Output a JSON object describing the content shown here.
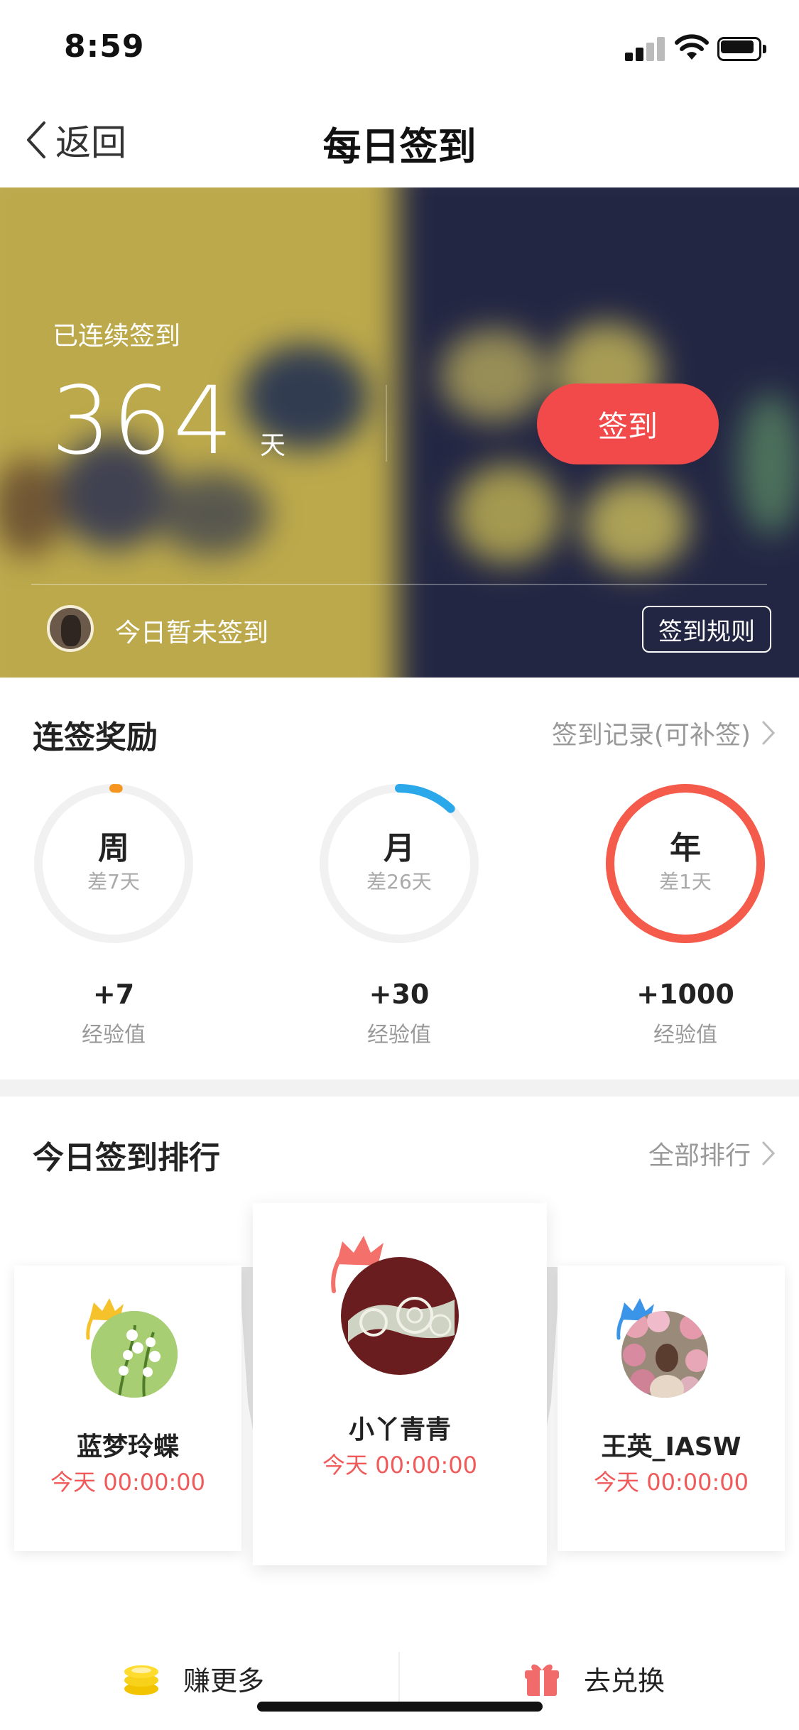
{
  "status_bar": {
    "time": "8:59"
  },
  "nav": {
    "back_label": "返回",
    "title": "每日签到"
  },
  "hero": {
    "streak_label": "已连续签到",
    "streak_days": "364",
    "streak_unit": "天",
    "checkin_button": "签到",
    "today_status": "今日暂未签到",
    "rules_button": "签到规则"
  },
  "rewards": {
    "title": "连签奖励",
    "record_link": "签到记录(可补签)",
    "items": [
      {
        "period": "周",
        "remaining": "差7天",
        "amount": "+7",
        "unit": "经验值",
        "progress": 0.01,
        "color": "#f5941e"
      },
      {
        "period": "月",
        "remaining": "差26天",
        "amount": "+30",
        "unit": "经验值",
        "progress": 0.12,
        "color": "#2aa8ea"
      },
      {
        "period": "年",
        "remaining": "差1天",
        "amount": "+1000",
        "unit": "经验值",
        "progress": 1.0,
        "color": "#f45b4b"
      }
    ]
  },
  "ranking": {
    "title": "今日签到排行",
    "all_link": "全部排行",
    "entries": [
      {
        "rank": 2,
        "name": "蓝梦玲蝶",
        "time": "今天 00:00:00",
        "crown_color": "#f5c22b"
      },
      {
        "rank": 1,
        "name": "小丫青青",
        "time": "今天 00:00:00",
        "crown_color": "#f4706a"
      },
      {
        "rank": 3,
        "name": "王英_IASW",
        "time": "今天 00:00:00",
        "crown_color": "#3a95e8"
      }
    ]
  },
  "bottom_bar": {
    "earn_label": "赚更多",
    "redeem_label": "去兑换"
  },
  "colors": {
    "accent_red": "#f24a4a",
    "rank_time": "#f05a5a"
  }
}
